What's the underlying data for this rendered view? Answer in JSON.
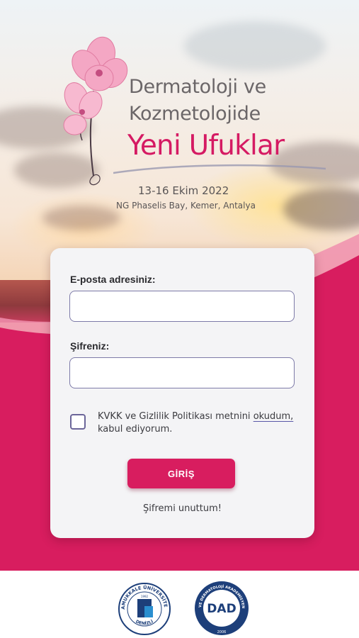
{
  "event": {
    "title_line1": "Dermatoloji ve",
    "title_line2": "Kozmetolojide",
    "title_line3": "Yeni Ufuklar",
    "dates": "13-16 Ekim 2022",
    "venue": "NG Phaselis Bay, Kemer, Antalya"
  },
  "login": {
    "email_label": "E-posta adresiniz:",
    "email_value": "",
    "password_label": "Şifreniz:",
    "password_value": "",
    "consent_text_before": "KVKK ve Gizlilik Politikası metnini ",
    "consent_link": "okudum,",
    "consent_text_after": " kabul ediyorum.",
    "consent_checked": false,
    "submit_label": "GİRİŞ",
    "forgot_label": "Şifremi unuttum!"
  },
  "footer": {
    "logo1_arc_text": "PAMUKKALE ÜNİVERSİTESİ",
    "logo1_bottom_text": "DENİZLİ",
    "logo1_year": "1992",
    "logo2_initials": "DAD",
    "logo2_arc_text": "DERMATOLOJİ VE DERMATOLOJİ AKADEMİSYENLERİ DERNEĞİ",
    "logo2_year": "2006"
  },
  "colors": {
    "brand_magenta": "#d81d5f",
    "title_gray": "#6b6668",
    "input_border": "#7d7aa8",
    "logo_blue": "#1d3f7a"
  }
}
